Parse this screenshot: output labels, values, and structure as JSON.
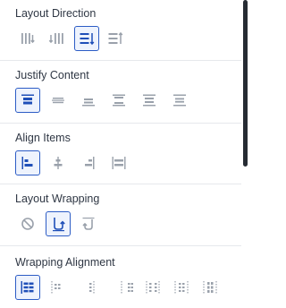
{
  "sections": {
    "layout_direction": {
      "label": "Layout Direction",
      "options": [
        "row-icon",
        "row-reverse-icon",
        "column-icon",
        "column-reverse-icon"
      ],
      "selected_index": 2
    },
    "justify_content": {
      "label": "Justify Content",
      "options": [
        "justify-start-icon",
        "justify-center-icon",
        "justify-end-icon",
        "justify-space-between-icon",
        "justify-space-around-icon",
        "justify-space-evenly-icon"
      ],
      "selected_index": 0
    },
    "align_items": {
      "label": "Align Items",
      "options": [
        "align-start-icon",
        "align-center-icon",
        "align-end-icon",
        "align-stretch-icon"
      ],
      "selected_index": 0
    },
    "layout_wrapping": {
      "label": "Layout Wrapping",
      "options": [
        "no-wrap-icon",
        "wrap-icon",
        "wrap-reverse-icon"
      ],
      "selected_index": 1
    },
    "wrapping_alignment": {
      "label": "Wrapping Alignment",
      "options": [
        "wrap-align-start-icon",
        "wrap-align-center-icon",
        "wrap-align-end-icon",
        "wrap-align-space-between-icon",
        "wrap-align-space-around-icon",
        "wrap-align-space-evenly-icon",
        "wrap-align-stretch-icon"
      ],
      "selected_index": 0
    }
  },
  "colors": {
    "active_border": "#2c5cc5",
    "active_icon": "#1f4fb8",
    "inactive_icon": "#9aa1ab",
    "label": "#2f3744"
  }
}
